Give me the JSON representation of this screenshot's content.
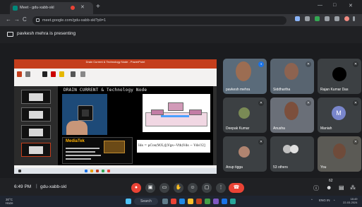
{
  "browser": {
    "tab_title": "Meet - gdu-xabb-skl",
    "new_tab": "+",
    "url": "meet.google.com/gdu-xabb-skl?pli=1",
    "window_controls": [
      "—",
      "□",
      "✕"
    ],
    "nav": [
      "←",
      "→",
      "C"
    ]
  },
  "presenting_banner": "pavkesh mehra is presenting",
  "shared_screen": {
    "ppt_title": "Drain Current & Technology Node - PowerPoint",
    "slide_title": "DRAIN CURRENT & Technology Node",
    "mediatek_label": "MediaTek",
    "formula": "Ids = μCox(W/L)[(Vgs−Vth)Vds − Vds²/2]"
  },
  "participants": [
    {
      "name": "pavkesh mehra",
      "mic": "active"
    },
    {
      "name": "Siddhartha",
      "mic": "off"
    },
    {
      "name": "Rajan Kumar Das",
      "mic": "off"
    },
    {
      "name": "Deepak Kumar",
      "mic": "off"
    },
    {
      "name": "Anusha",
      "mic": "off"
    },
    {
      "name": "Maniah",
      "mic": "off",
      "initial": "M"
    },
    {
      "name": "Anup tigga",
      "mic": "off"
    },
    {
      "name": "53 others",
      "mic": "none"
    },
    {
      "name": "You",
      "mic": "off"
    }
  ],
  "meeting": {
    "time": "6:49 PM",
    "separator": "|",
    "code": "gdu-xabb-skl",
    "participant_count": "62"
  },
  "controls": {
    "mic": "mic-off-icon",
    "camera": "camera-icon",
    "captions": "captions-icon",
    "raise_hand": "hand-icon",
    "emoji": "emoji-icon",
    "present": "present-icon",
    "more": "more-vert-icon",
    "hangup": "call-end-icon"
  },
  "os": {
    "weather_temp": "30°C",
    "weather_desc": "Haze",
    "search": "Search",
    "lang": "ENG IN",
    "time": "18:49",
    "date": "22-03-2024"
  },
  "colors": {
    "accent_red": "#ea4335",
    "active_blue": "#1a73e8",
    "tile_bg": "#3c4043",
    "ppt_orange": "#c43e1c"
  }
}
